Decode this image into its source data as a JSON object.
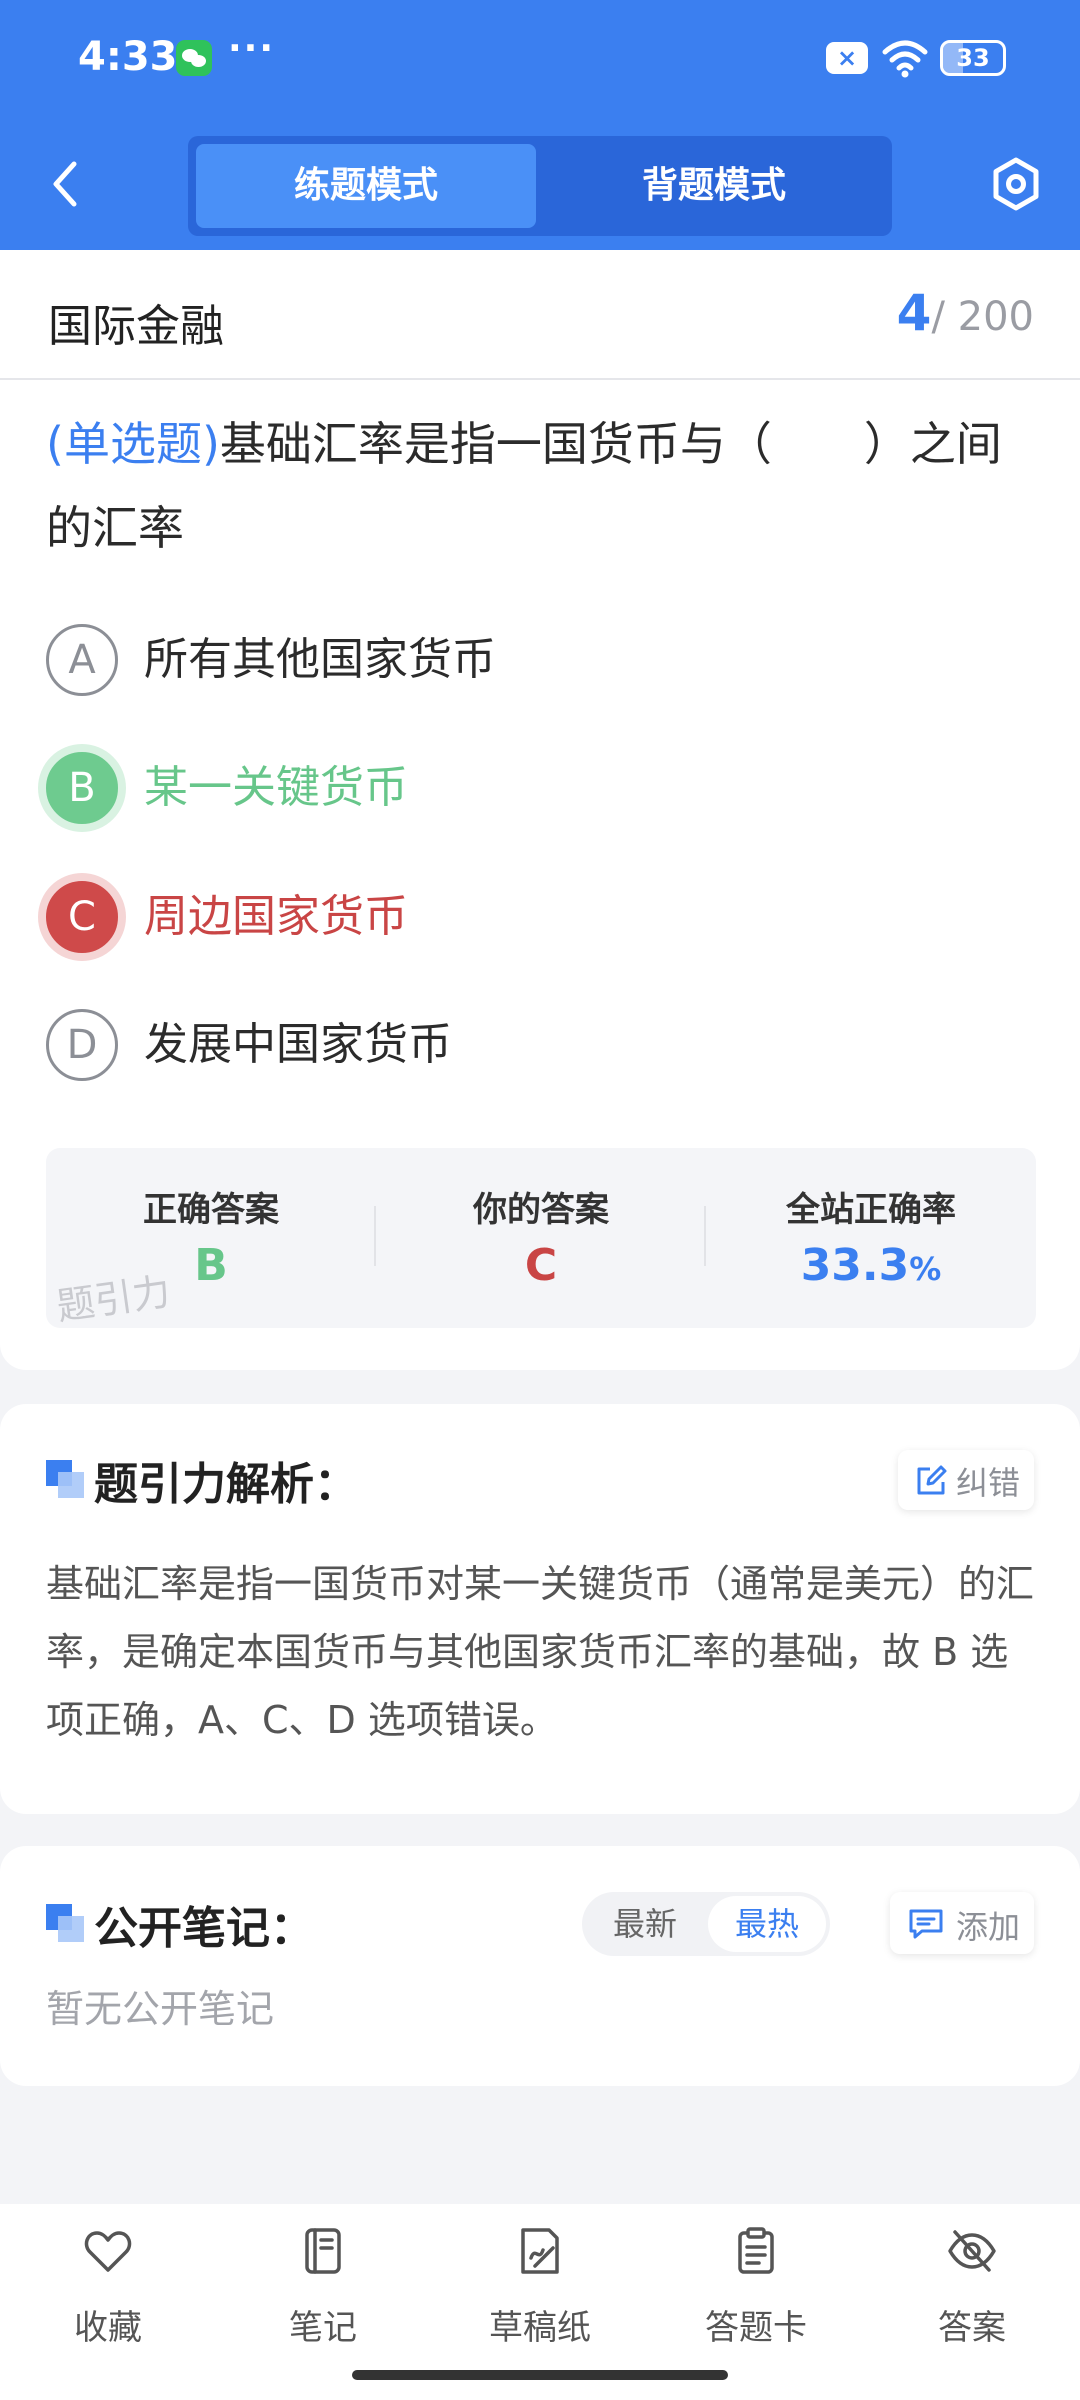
{
  "status_bar": {
    "time": "4:33",
    "more": "···",
    "battery_level": "33",
    "icons": [
      "wechat-icon",
      "close-box-icon",
      "wifi-icon",
      "battery-icon"
    ]
  },
  "nav": {
    "mode_tabs": [
      "练题模式",
      "背题模式"
    ],
    "active_tab": "练题模式",
    "icons": [
      "chevron-left-icon",
      "gear-icon"
    ]
  },
  "question": {
    "subject": "国际金融",
    "current": "4",
    "total": "/ 200",
    "type_label": "(单选题)",
    "stem": "基础汇率是指一国货币与（　　）之间的汇率",
    "options": [
      {
        "letter": "A",
        "text": "所有其他国家货币",
        "state": "normal"
      },
      {
        "letter": "B",
        "text": "某一关键货币",
        "state": "correct"
      },
      {
        "letter": "C",
        "text": "周边国家货币",
        "state": "wrong"
      },
      {
        "letter": "D",
        "text": "发展中国家货币",
        "state": "normal"
      }
    ]
  },
  "stats": {
    "correct_label": "正确答案",
    "correct_value": "B",
    "yours_label": "你的答案",
    "yours_value": "C",
    "rate_label": "全站正确率",
    "rate_value": "33.3",
    "rate_unit": "%",
    "watermark": "题引力",
    "colors": {
      "correct": "#67c68a",
      "wrong": "#c94545",
      "rate": "#3b7ff0"
    }
  },
  "analysis": {
    "title": "题引力解析：",
    "fix_label": "纠错",
    "text": "基础汇率是指一国货币对某一关键货币（通常是美元）的汇率，是确定本国货币与其他国家货币汇率的基础，故 B 选项正确，A、C、D 选项错误。"
  },
  "notes": {
    "title": "公开笔记：",
    "sort_latest": "最新",
    "sort_hot": "最热",
    "add_label": "添加",
    "empty_text": "暂无公开笔记"
  },
  "bottom_bar": {
    "items": [
      {
        "label": "收藏",
        "icon": "heart-icon"
      },
      {
        "label": "笔记",
        "icon": "notebook-icon"
      },
      {
        "label": "草稿纸",
        "icon": "draft-paper-icon"
      },
      {
        "label": "答题卡",
        "icon": "answer-sheet-icon"
      },
      {
        "label": "答案",
        "icon": "eye-off-icon"
      }
    ]
  },
  "theme": {
    "primary": "#3b7ff0"
  }
}
